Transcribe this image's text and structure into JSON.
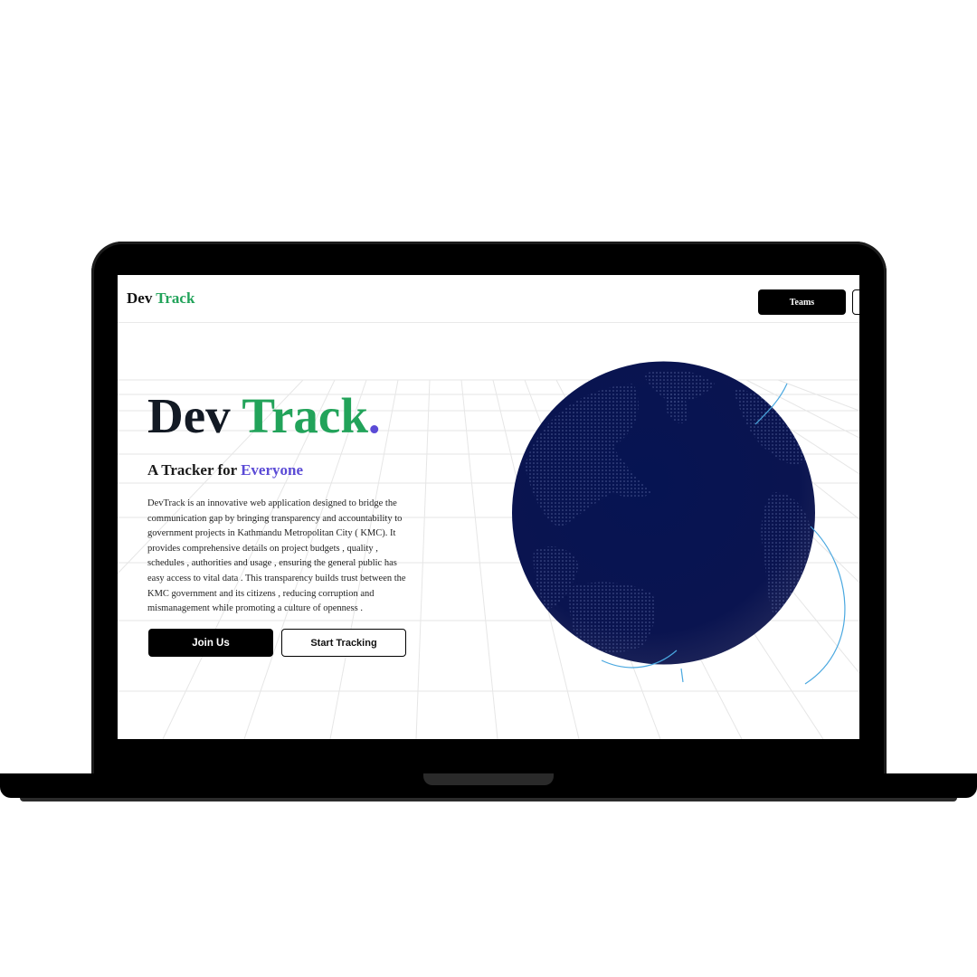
{
  "navbar": {
    "logo_part1": "Dev",
    "logo_part2": "Track",
    "teams_label": "Teams"
  },
  "hero": {
    "title_part1": "Dev",
    "title_part2": "Track",
    "title_dot": ".",
    "subtitle_part1": "A Tracker for",
    "subtitle_part2": "Everyone",
    "description": "DevTrack is an innovative web application designed to bridge the communication gap by bringing transparency and accountability to government projects in Kathmandu Metropolitan City ( KMC). It provides comprehensive details on project budgets , quality , schedules , authorities and usage , ensuring the general public has easy access to vital data . This transparency builds trust between the KMC government and its citizens , reducing corruption and mismanagement while promoting a culture of openness .",
    "join_label": "Join Us",
    "track_label": "Start Tracking"
  },
  "colors": {
    "accent_green": "#22a35a",
    "accent_purple": "#5b4bd6",
    "globe_navy": "#0a1450",
    "arc_blue": "#4aa8e0"
  }
}
